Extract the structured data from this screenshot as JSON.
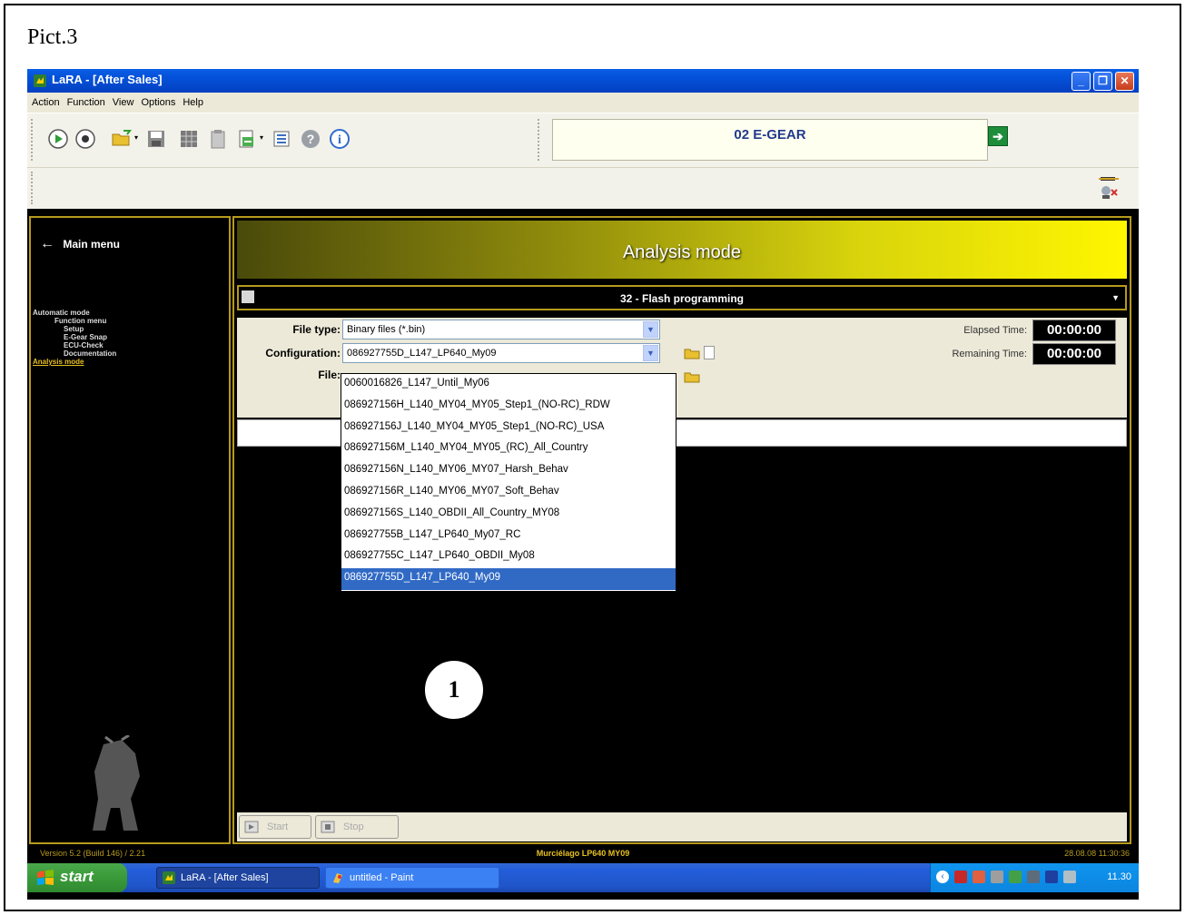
{
  "caption": "Pict.3",
  "window": {
    "title": "LaRA - [After Sales]",
    "controls": [
      "minimize",
      "restore",
      "close"
    ]
  },
  "menu": [
    "Action",
    "Function",
    "View",
    "Options",
    "Help"
  ],
  "toolbar": {
    "icons": [
      "play-icon",
      "stop-icon",
      "open-folder-icon",
      "save-icon",
      "grid-icon",
      "clipboard-icon",
      "export-icon",
      "list-icon",
      "help-icon",
      "info-icon"
    ],
    "module": "02  E-GEAR"
  },
  "sidebar": {
    "back_label": "Main menu",
    "items": [
      {
        "label": "Automatic mode",
        "level": 0
      },
      {
        "label": "Function menu",
        "level": 1
      },
      {
        "label": "Setup",
        "level": 2
      },
      {
        "label": "E-Gear Snap",
        "level": 2
      },
      {
        "label": "ECU-Check",
        "level": 2
      },
      {
        "label": "Documentation",
        "level": 2
      },
      {
        "label": "Analysis mode",
        "level": 0,
        "active": true
      }
    ]
  },
  "content": {
    "header": "Analysis mode",
    "function": "32 - Flash programming",
    "file_type_label": "File type:",
    "file_type_value": "Binary files (*.bin)",
    "configuration_label": "Configuration:",
    "configuration_value": "086927755D_L147_LP640_My09",
    "file_label": "File:",
    "elapsed_label": "Elapsed Time:",
    "elapsed_value": "00:00:00",
    "remaining_label": "Remaining Time:",
    "remaining_value": "00:00:00",
    "start_label": "Start",
    "stop_label": "Stop"
  },
  "dropdown": {
    "options": [
      "0060016826_L147_Until_My06",
      "086927156H_L140_MY04_MY05_Step1_(NO-RC)_RDW",
      "086927156J_L140_MY04_MY05_Step1_(NO-RC)_USA",
      "086927156M_L140_MY04_MY05_(RC)_All_Country",
      "086927156N_L140_MY06_MY07_Harsh_Behav",
      "086927156R_L140_MY06_MY07_Soft_Behav",
      "086927156S_L140_OBDII_All_Country_MY08",
      "086927755B_L147_LP640_My07_RC",
      "086927755C_L147_LP640_OBDII_My08",
      "086927755D_L147_LP640_My09"
    ],
    "selected_index": 9
  },
  "status": {
    "version": "Version 5.2 (Build 146) / 2.21",
    "vehicle": "Murciélago LP640 MY09",
    "timestamp": "28.08.08 11:30:36"
  },
  "taskbar": {
    "start": "start",
    "tasks": [
      {
        "label": "LaRA - [After Sales]",
        "active": true
      },
      {
        "label": "untitled - Paint",
        "active": false
      }
    ],
    "clock": "11.30"
  },
  "callout": "1",
  "colors": {
    "accent_gold": "#b79a1c",
    "header_yellow": "#fff600",
    "selection_blue": "#316ac5"
  }
}
